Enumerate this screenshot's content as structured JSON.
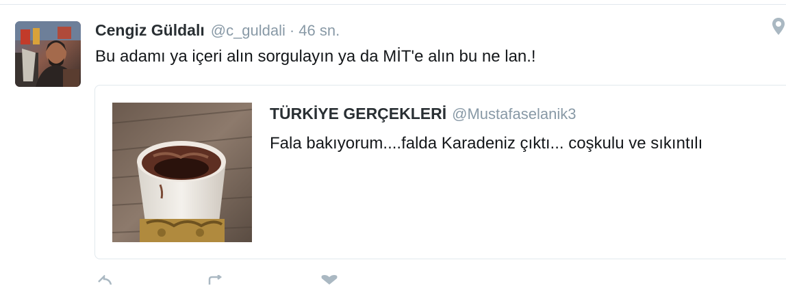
{
  "tweet": {
    "author_name": "Cengiz Güldalı",
    "author_handle": "@c_guldali",
    "separator": "·",
    "timestamp": "46 sn.",
    "text": "Bu adamı ya içeri alın sorgulayın ya da MİT'e alın bu ne lan.!",
    "avatar_icon": "profile-photo",
    "location_icon": "map-pin-icon"
  },
  "quoted_tweet": {
    "author_name": "TÜRKİYE GERÇEKLERİ",
    "author_handle": "@Mustafaselanik3",
    "text": "Fala bakıyorum....falda Karadeniz çıktı... coşkulu ve sıkıntılı",
    "photo": "coffee-cup-photo"
  },
  "actions": {
    "icons": [
      "reply-icon",
      "retweet-icon",
      "like-icon"
    ]
  },
  "colors": {
    "name": "#292f33",
    "secondary": "#8899a6",
    "text": "#14171a",
    "border": "#e1e8ed"
  }
}
